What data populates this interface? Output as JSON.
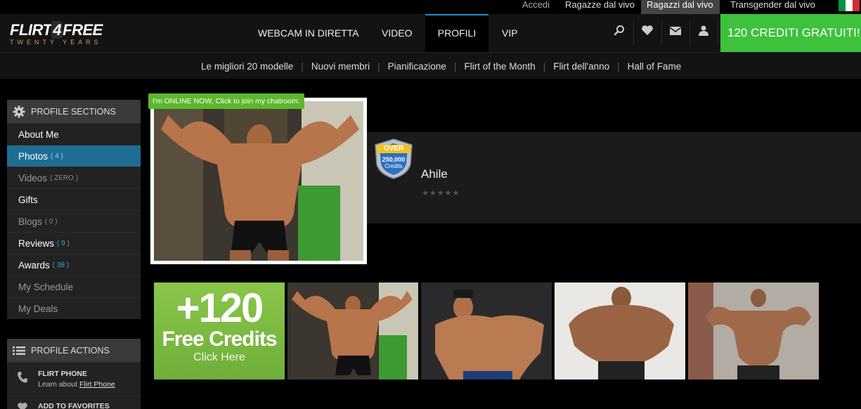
{
  "topbar": {
    "login": "Accedi",
    "girls": "Ragazze dal vivo",
    "guys": "Ragazzi dal vivo",
    "trans": "Transgender dal vivo",
    "flag_colors": [
      "#009246",
      "#ffffff",
      "#ce2b37"
    ]
  },
  "logo": {
    "part1": "FLIRT",
    "part2": "4",
    "part3": "FREE",
    "tagline": "TWENTY YEARS"
  },
  "nav": {
    "webcam": "WEBCAM IN DIRETTA",
    "video": "VIDEO",
    "profili": "PROFILI",
    "vip": "VIP",
    "icons": [
      "search-icon",
      "heart-icon",
      "mail-icon",
      "user-icon"
    ],
    "credits_button": "120 CREDITI GRATUITI!",
    "accent_color": "#3ec13c"
  },
  "subnav": {
    "items": [
      "Le migliori 20 modelle",
      "Nuovi membri",
      "Pianificazione",
      "Flirt of the Month",
      "Flirt dell'anno",
      "Hall of Fame"
    ]
  },
  "profile_sections": {
    "title": "PROFILE SECTIONS",
    "items": [
      {
        "label": "About Me",
        "count": ""
      },
      {
        "label": "Photos",
        "count": "( 4 )"
      },
      {
        "label": "Videos",
        "count": "( ZERO )"
      },
      {
        "label": "Gifts",
        "count": ""
      },
      {
        "label": "Blogs",
        "count": "( 0 )"
      },
      {
        "label": "Reviews",
        "count": "( 9 )"
      },
      {
        "label": "Awards",
        "count": "( 38 )"
      },
      {
        "label": "My Schedule",
        "count": ""
      },
      {
        "label": "My Deals",
        "count": ""
      }
    ]
  },
  "profile_actions": {
    "title": "PROFILE ACTIONS",
    "flirt_phone_title": "FLIRT PHONE",
    "flirt_phone_sub_prefix": "Learn about",
    "flirt_phone_link": "Flirt Phone",
    "next_item_title": "ADD TO FAVORITES"
  },
  "profile": {
    "online_tag": "I'm ONLINE NOW, Click to join my chatroom.",
    "badge_top": "OVER",
    "badge_mid": "250,000",
    "badge_bottom": "Credits",
    "name": "Ahile",
    "stars": "★★★★★"
  },
  "promo": {
    "big": "+120",
    "mid": "Free Credits",
    "small": "Click Here"
  }
}
